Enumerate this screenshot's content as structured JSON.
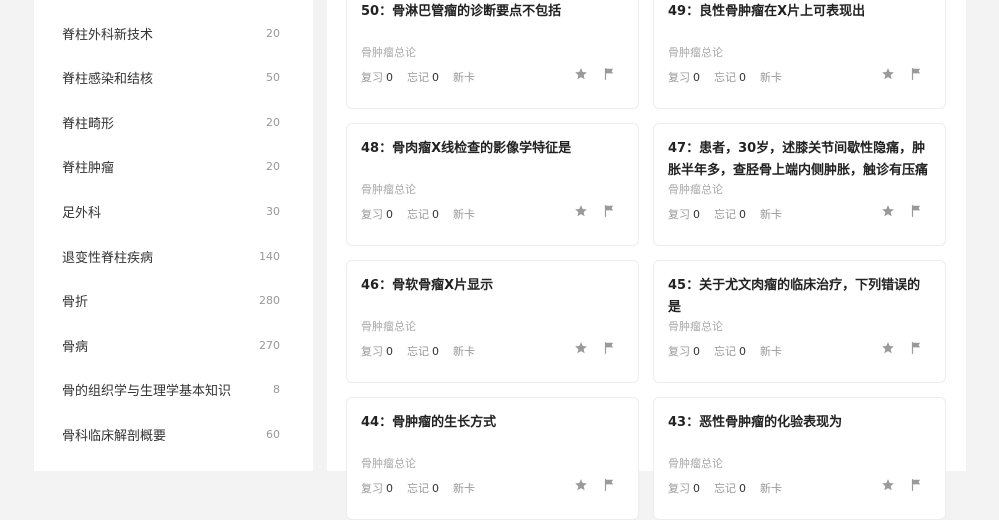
{
  "sidebar": {
    "items": [
      {
        "label": "脊柱外科新技术",
        "count": "20"
      },
      {
        "label": "脊柱感染和结核",
        "count": "50"
      },
      {
        "label": "脊柱畸形",
        "count": "20"
      },
      {
        "label": "脊柱肿瘤",
        "count": "20"
      },
      {
        "label": "足外科",
        "count": "30"
      },
      {
        "label": "退变性脊柱疾病",
        "count": "140"
      },
      {
        "label": "骨折",
        "count": "280"
      },
      {
        "label": "骨病",
        "count": "270"
      },
      {
        "label": "骨的组织学与生理学基本知识",
        "count": "8"
      },
      {
        "label": "骨科临床解剖概要",
        "count": "60"
      }
    ]
  },
  "stat_labels": {
    "review": "复习",
    "forget": "忘记",
    "new": "新卡"
  },
  "cards": [
    {
      "title": "50：骨淋巴管瘤的诊断要点不包括",
      "category": "骨肿瘤总论",
      "review": "0",
      "forget": "0"
    },
    {
      "title": "49：良性骨肿瘤在X片上可表现出",
      "category": "骨肿瘤总论",
      "review": "0",
      "forget": "0"
    },
    {
      "title": "48：骨肉瘤X线检查的影像学特征是",
      "category": "骨肿瘤总论",
      "review": "0",
      "forget": "0"
    },
    {
      "title": "47：患者，30岁，述膝关节间歇性隐痛，肿胀半年多，查胫骨上端内侧肿胀，触诊有压痛",
      "category": "骨肿瘤总论",
      "review": "0",
      "forget": "0"
    },
    {
      "title": "46：骨软骨瘤X片显示",
      "category": "骨肿瘤总论",
      "review": "0",
      "forget": "0"
    },
    {
      "title": "45：关于尤文肉瘤的临床治疗，下列错误的是",
      "category": "骨肿瘤总论",
      "review": "0",
      "forget": "0"
    },
    {
      "title": "44：骨肿瘤的生长方式",
      "category": "骨肿瘤总论",
      "review": "0",
      "forget": "0"
    },
    {
      "title": "43：恶性骨肿瘤的化验表现为",
      "category": "骨肿瘤总论",
      "review": "0",
      "forget": "0"
    }
  ],
  "colors": {
    "icon": "#9a9a9a"
  },
  "icons": {
    "favorite": "star-icon",
    "flag": "flag-icon"
  }
}
